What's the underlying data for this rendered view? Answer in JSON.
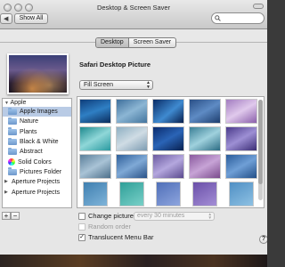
{
  "window": {
    "title": "Desktop & Screen Saver"
  },
  "toolbar": {
    "show_all": "Show All",
    "nav_left_glyph": "◀",
    "nav_right_glyph": "▶"
  },
  "search": {
    "placeholder": "",
    "value": ""
  },
  "tabs": [
    {
      "label": "Desktop",
      "active": true
    },
    {
      "label": "Screen Saver",
      "active": false
    }
  ],
  "current_picture": {
    "name": "Safari Desktop Picture"
  },
  "fill_mode": {
    "selected": "Fill Screen"
  },
  "sources": {
    "apple_group": "Apple",
    "items": [
      {
        "label": "Apple Images",
        "icon": "folder-icon",
        "selected": true
      },
      {
        "label": "Nature",
        "icon": "folder-icon",
        "selected": false
      },
      {
        "label": "Plants",
        "icon": "folder-icon",
        "selected": false
      },
      {
        "label": "Black & White",
        "icon": "folder-icon",
        "selected": false
      },
      {
        "label": "Abstract",
        "icon": "folder-icon",
        "selected": false
      },
      {
        "label": "Solid Colors",
        "icon": "color-wheel-icon",
        "selected": false
      },
      {
        "label": "Pictures Folder",
        "icon": "folder-icon",
        "selected": false
      }
    ],
    "collapsed_groups": [
      "Aperture Projects",
      "Aperture Projects"
    ]
  },
  "source_buttons": {
    "add": "+",
    "remove": "−"
  },
  "thumbnails": [
    "linear-gradient(160deg,#0e3d7a,#2f7fc4 50%,#0b2c5c)",
    "linear-gradient(150deg,#3e6f9c,#8cb6d4 50%,#43759e)",
    "linear-gradient(140deg,#0a2c66,#3f8ad0 55%,#081f4d)",
    "linear-gradient(150deg,#2a4f86,#5e8bc4 50%,#1d3d6e)",
    "linear-gradient(150deg,#a27cc0,#e0c9ec 50%,#8a5fab)",
    "linear-gradient(150deg,#1f8a8f,#8fd7d8 50%,#2a9aa0)",
    "linear-gradient(150deg,#8fb0c3,#cfdce4 50%,#7d9cb2)",
    "linear-gradient(150deg,#0b2c6e,#2a64b6 50%,#08204f)",
    "linear-gradient(150deg,#3b7f96,#9fd1dd 50%,#2b6b83)",
    "linear-gradient(150deg,#4a3a8a,#9d8fd4 50%,#3a2c74)",
    "linear-gradient(150deg,#5b7f9a,#a9c3d6 50%,#4c6f8a)",
    "linear-gradient(150deg,#2f5f9a,#7fa9d6 50%,#2a5288)",
    "linear-gradient(150deg,#6b5ba0,#b4a7de 50%,#5a4a8e)",
    "linear-gradient(150deg,#8a5a9e,#c7a3d6 50%,#7a4a8c)",
    "linear-gradient(150deg,#2a5c9a,#6f9fd6 50%,#234f88)",
    "linear-gradient(150deg,#3f7fb0,#7fb4d9)",
    "linear-gradient(150deg,#2f9f98,#79d0c8)",
    "linear-gradient(150deg,#4f6fb8,#8ea5de)",
    "linear-gradient(150deg,#6a4fa8,#a48fd6)",
    "linear-gradient(150deg,#4f8fc4,#8ec1e3)"
  ],
  "options": {
    "change_picture": "Change picture:",
    "change_picture_checked": false,
    "interval": "every 30 minutes",
    "random_order": "Random order",
    "random_order_checked": false,
    "translucent_menu_bar": "Translucent Menu Bar",
    "translucent_menu_bar_checked": true,
    "check_glyph": "✓"
  },
  "help": {
    "label": "?"
  }
}
